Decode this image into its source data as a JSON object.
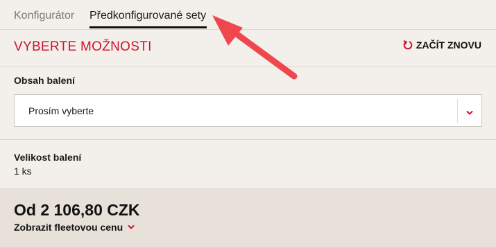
{
  "tabs": [
    {
      "label": "Konfigurátor",
      "active": false
    },
    {
      "label": "Předkonfigurované sety",
      "active": true
    }
  ],
  "options": {
    "title": "VYBERTE MOŽNOSTI",
    "restart_label": "ZAČÍT ZNOVU",
    "restart_icon": "refresh-icon"
  },
  "package_content": {
    "label": "Obsah balení",
    "select_value": "Prosím vyberte",
    "select_icon": "chevron-down-icon"
  },
  "package_size": {
    "label": "Velikost balení",
    "value": "1 ks"
  },
  "price": {
    "amount": "Od 2 106,80 CZK",
    "fleet_link": "Zobrazit fleetovou cenu",
    "fleet_icon": "chevron-down-icon"
  },
  "colors": {
    "accent_red": "#d0122d",
    "background": "#f3efeb",
    "price_background": "#e7e1da",
    "annotation_arrow": "#f0474f"
  }
}
